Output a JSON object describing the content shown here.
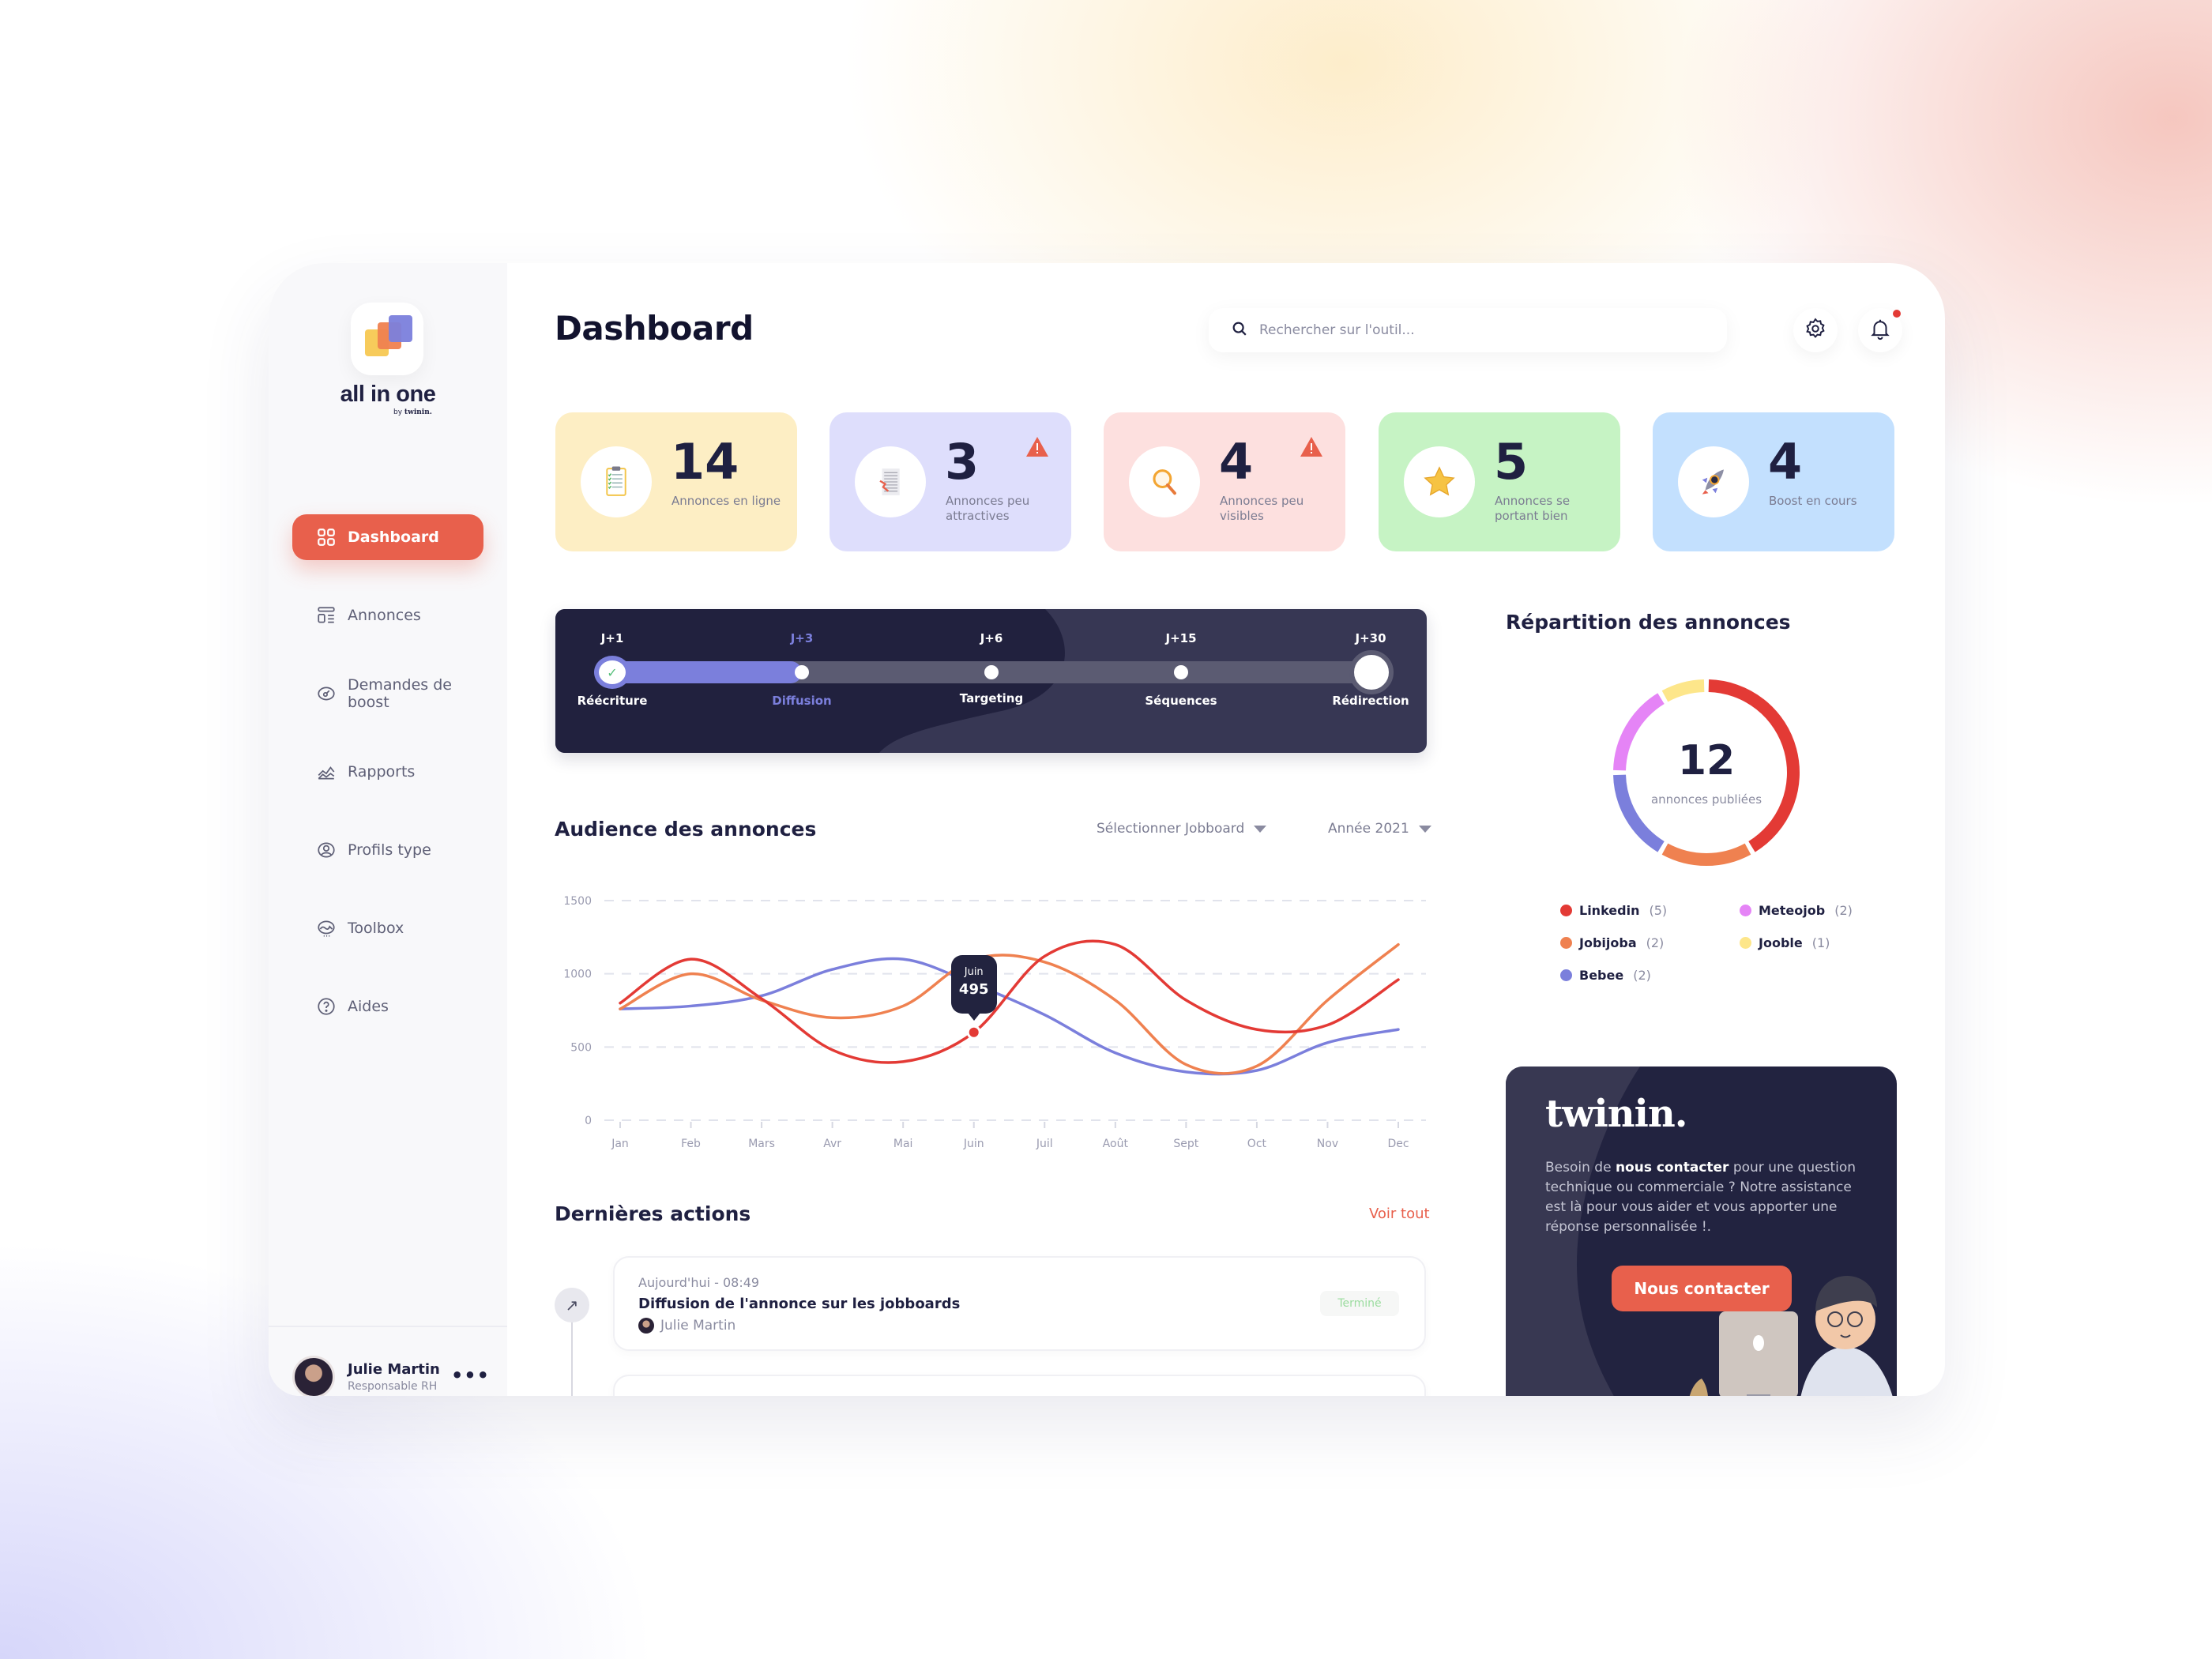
{
  "sidebar": {
    "brand": "all in one",
    "brand_by": "by",
    "brand_company": "twinin.",
    "items": [
      {
        "label": "Dashboard",
        "icon": "grid-icon",
        "active": true
      },
      {
        "label": "Annonces",
        "icon": "list-layout-icon"
      },
      {
        "label": "Demandes de boost",
        "icon": "gauge-icon"
      },
      {
        "label": "Rapports",
        "icon": "area-chart-icon"
      },
      {
        "label": "Profils type",
        "icon": "user-circle-icon"
      },
      {
        "label": "Toolbox",
        "icon": "toolbox-icon"
      },
      {
        "label": "Aides",
        "icon": "help-circle-icon"
      }
    ],
    "user": {
      "name": "Julie Martin",
      "role": "Responsable RH",
      "menu": "•••"
    }
  },
  "header": {
    "title": "Dashboard",
    "search_placeholder": "Rechercher sur l'outil...",
    "notification_dot": true
  },
  "stats": [
    {
      "value": "14",
      "label": "Annonces en ligne",
      "color": "#fdeec4",
      "icon": "clipboard-icon",
      "warning": false
    },
    {
      "value": "3",
      "label": "Annonces peu attractives",
      "color": "#dedefc",
      "icon": "document-decline-icon",
      "warning": true
    },
    {
      "value": "4",
      "label": "Annonces peu visibles",
      "color": "#fde0df",
      "icon": "magnifier-icon",
      "warning": true
    },
    {
      "value": "5",
      "label": "Annonces se portant bien",
      "color": "#c6f3c4",
      "icon": "star-icon",
      "warning": false
    },
    {
      "value": "4",
      "label": "Boost en cours",
      "color": "#c3e0fe",
      "icon": "rocket-icon",
      "warning": false
    }
  ],
  "steps": {
    "progress": 0.25,
    "items": [
      {
        "day": "J+1",
        "name": "Réécriture",
        "state": "done"
      },
      {
        "day": "J+3",
        "name": "Diffusion",
        "state": "current"
      },
      {
        "day": "J+6",
        "name": "Targeting",
        "state": "todo"
      },
      {
        "day": "J+15",
        "name": "Séquences",
        "state": "todo"
      },
      {
        "day": "J+30",
        "name": "Rédirection",
        "state": "end"
      }
    ]
  },
  "audience": {
    "title": "Audience des annonces",
    "jobboard_select": "Sélectionner Jobboard",
    "year_select": "Année 2021",
    "tooltip": {
      "month": "Juin",
      "value": "495"
    }
  },
  "chart_data": {
    "type": "line",
    "title": "Audience des annonces",
    "x": [
      "Jan",
      "Feb",
      "Mars",
      "Avr",
      "Mai",
      "Juin",
      "Juil",
      "Août",
      "Sept",
      "Oct",
      "Nov",
      "Dec"
    ],
    "yticks": [
      0,
      500,
      1000,
      1500
    ],
    "ylim": [
      0,
      1500
    ],
    "grid": true,
    "series": [
      {
        "name": "Linkedin",
        "color": "#e33a35",
        "values": [
          800,
          1100,
          830,
          480,
          400,
          600,
          1120,
          1200,
          820,
          620,
          650,
          960
        ]
      },
      {
        "name": "Jobijoba",
        "color": "#ef8150",
        "values": [
          760,
          1000,
          820,
          700,
          780,
          1100,
          1080,
          820,
          380,
          370,
          820,
          1200
        ]
      },
      {
        "name": "Bebee",
        "color": "#7b7fdc",
        "values": [
          760,
          780,
          850,
          1030,
          1100,
          930,
          720,
          460,
          330,
          340,
          530,
          620
        ]
      }
    ],
    "highlight": {
      "series": "Linkedin",
      "x": "Juin",
      "label": "495"
    }
  },
  "repartition": {
    "title": "Répartition des annonces",
    "total": "12",
    "total_label": "annonces publiées",
    "segments": [
      {
        "name": "Linkedin",
        "count": 5,
        "color": "#e33a35"
      },
      {
        "name": "Jobijoba",
        "count": 2,
        "color": "#ef8150"
      },
      {
        "name": "Bebee",
        "count": 2,
        "color": "#7b7fdc"
      },
      {
        "name": "Meteojob",
        "count": 2,
        "color": "#e584f6"
      },
      {
        "name": "Jooble",
        "count": 1,
        "color": "#fde68a"
      }
    ]
  },
  "actions": {
    "title": "Dernières actions",
    "see_all": "Voir tout",
    "items": [
      {
        "time": "Aujourd'hui - 08:49",
        "title": "Diffusion de l'annonce sur les jobboards",
        "user": "Julie Martin",
        "status": "Terminé"
      }
    ]
  },
  "contact": {
    "brand": "twinin.",
    "text_before": "Besoin de ",
    "text_bold": "nous contacter",
    "text_after": " pour une question technique ou commerciale ? Notre assistance est là pour vous aider et vous apporter une réponse personnalisée !.",
    "button": "Nous contacter"
  }
}
